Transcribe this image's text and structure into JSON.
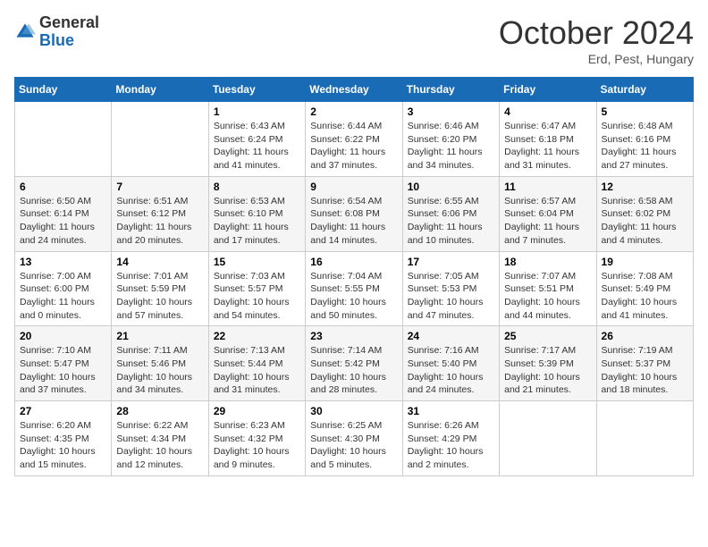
{
  "logo": {
    "general": "General",
    "blue": "Blue"
  },
  "header": {
    "month_year": "October 2024",
    "location": "Erd, Pest, Hungary"
  },
  "weekdays": [
    "Sunday",
    "Monday",
    "Tuesday",
    "Wednesday",
    "Thursday",
    "Friday",
    "Saturday"
  ],
  "weeks": [
    [
      {
        "day": "",
        "info": ""
      },
      {
        "day": "",
        "info": ""
      },
      {
        "day": "1",
        "info": "Sunrise: 6:43 AM\nSunset: 6:24 PM\nDaylight: 11 hours and 41 minutes."
      },
      {
        "day": "2",
        "info": "Sunrise: 6:44 AM\nSunset: 6:22 PM\nDaylight: 11 hours and 37 minutes."
      },
      {
        "day": "3",
        "info": "Sunrise: 6:46 AM\nSunset: 6:20 PM\nDaylight: 11 hours and 34 minutes."
      },
      {
        "day": "4",
        "info": "Sunrise: 6:47 AM\nSunset: 6:18 PM\nDaylight: 11 hours and 31 minutes."
      },
      {
        "day": "5",
        "info": "Sunrise: 6:48 AM\nSunset: 6:16 PM\nDaylight: 11 hours and 27 minutes."
      }
    ],
    [
      {
        "day": "6",
        "info": "Sunrise: 6:50 AM\nSunset: 6:14 PM\nDaylight: 11 hours and 24 minutes."
      },
      {
        "day": "7",
        "info": "Sunrise: 6:51 AM\nSunset: 6:12 PM\nDaylight: 11 hours and 20 minutes."
      },
      {
        "day": "8",
        "info": "Sunrise: 6:53 AM\nSunset: 6:10 PM\nDaylight: 11 hours and 17 minutes."
      },
      {
        "day": "9",
        "info": "Sunrise: 6:54 AM\nSunset: 6:08 PM\nDaylight: 11 hours and 14 minutes."
      },
      {
        "day": "10",
        "info": "Sunrise: 6:55 AM\nSunset: 6:06 PM\nDaylight: 11 hours and 10 minutes."
      },
      {
        "day": "11",
        "info": "Sunrise: 6:57 AM\nSunset: 6:04 PM\nDaylight: 11 hours and 7 minutes."
      },
      {
        "day": "12",
        "info": "Sunrise: 6:58 AM\nSunset: 6:02 PM\nDaylight: 11 hours and 4 minutes."
      }
    ],
    [
      {
        "day": "13",
        "info": "Sunrise: 7:00 AM\nSunset: 6:00 PM\nDaylight: 11 hours and 0 minutes."
      },
      {
        "day": "14",
        "info": "Sunrise: 7:01 AM\nSunset: 5:59 PM\nDaylight: 10 hours and 57 minutes."
      },
      {
        "day": "15",
        "info": "Sunrise: 7:03 AM\nSunset: 5:57 PM\nDaylight: 10 hours and 54 minutes."
      },
      {
        "day": "16",
        "info": "Sunrise: 7:04 AM\nSunset: 5:55 PM\nDaylight: 10 hours and 50 minutes."
      },
      {
        "day": "17",
        "info": "Sunrise: 7:05 AM\nSunset: 5:53 PM\nDaylight: 10 hours and 47 minutes."
      },
      {
        "day": "18",
        "info": "Sunrise: 7:07 AM\nSunset: 5:51 PM\nDaylight: 10 hours and 44 minutes."
      },
      {
        "day": "19",
        "info": "Sunrise: 7:08 AM\nSunset: 5:49 PM\nDaylight: 10 hours and 41 minutes."
      }
    ],
    [
      {
        "day": "20",
        "info": "Sunrise: 7:10 AM\nSunset: 5:47 PM\nDaylight: 10 hours and 37 minutes."
      },
      {
        "day": "21",
        "info": "Sunrise: 7:11 AM\nSunset: 5:46 PM\nDaylight: 10 hours and 34 minutes."
      },
      {
        "day": "22",
        "info": "Sunrise: 7:13 AM\nSunset: 5:44 PM\nDaylight: 10 hours and 31 minutes."
      },
      {
        "day": "23",
        "info": "Sunrise: 7:14 AM\nSunset: 5:42 PM\nDaylight: 10 hours and 28 minutes."
      },
      {
        "day": "24",
        "info": "Sunrise: 7:16 AM\nSunset: 5:40 PM\nDaylight: 10 hours and 24 minutes."
      },
      {
        "day": "25",
        "info": "Sunrise: 7:17 AM\nSunset: 5:39 PM\nDaylight: 10 hours and 21 minutes."
      },
      {
        "day": "26",
        "info": "Sunrise: 7:19 AM\nSunset: 5:37 PM\nDaylight: 10 hours and 18 minutes."
      }
    ],
    [
      {
        "day": "27",
        "info": "Sunrise: 6:20 AM\nSunset: 4:35 PM\nDaylight: 10 hours and 15 minutes."
      },
      {
        "day": "28",
        "info": "Sunrise: 6:22 AM\nSunset: 4:34 PM\nDaylight: 10 hours and 12 minutes."
      },
      {
        "day": "29",
        "info": "Sunrise: 6:23 AM\nSunset: 4:32 PM\nDaylight: 10 hours and 9 minutes."
      },
      {
        "day": "30",
        "info": "Sunrise: 6:25 AM\nSunset: 4:30 PM\nDaylight: 10 hours and 5 minutes."
      },
      {
        "day": "31",
        "info": "Sunrise: 6:26 AM\nSunset: 4:29 PM\nDaylight: 10 hours and 2 minutes."
      },
      {
        "day": "",
        "info": ""
      },
      {
        "day": "",
        "info": ""
      }
    ]
  ]
}
